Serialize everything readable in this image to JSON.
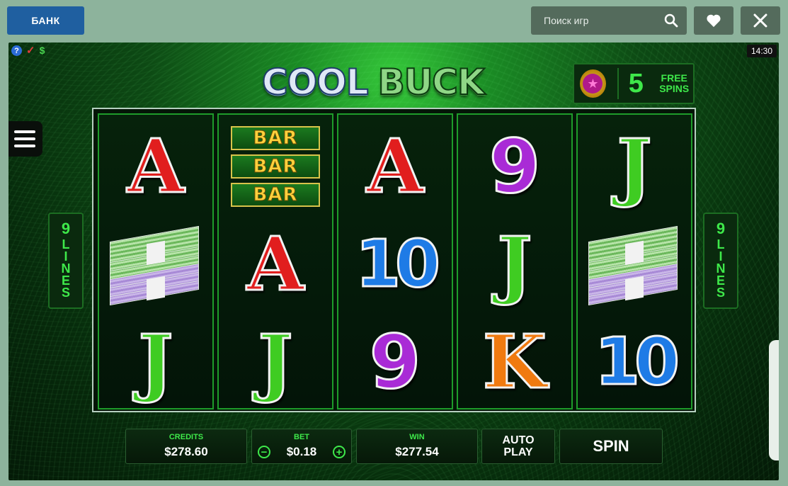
{
  "topbar": {
    "bank_label": "БАНК",
    "search_placeholder": "Поиск игр"
  },
  "icons": {
    "search": "search-icon",
    "favorite": "heart-icon",
    "close": "close-icon",
    "help": "?",
    "check": "✓",
    "dollar": "$"
  },
  "game": {
    "clock": "14:30",
    "logo_word1": "COOL",
    "logo_word2": "BUCK",
    "free_spins_count": "5",
    "free_spins_label_1": "FREE",
    "free_spins_label_2": "SPINS",
    "lines_number": "9",
    "lines_text": [
      "L",
      "I",
      "N",
      "E",
      "S"
    ]
  },
  "reels": [
    [
      "A",
      "cash",
      "J"
    ],
    [
      "BAR",
      "A",
      "J"
    ],
    [
      "A",
      "10",
      "9"
    ],
    [
      "9",
      "J",
      "K"
    ],
    [
      "J",
      "cash",
      "10"
    ]
  ],
  "bar_label": "BAR",
  "panel": {
    "credits_label": "CREDITS",
    "credits_value": "$278.60",
    "bet_label": "BET",
    "bet_value": "$0.18",
    "bet_minus": "−",
    "bet_plus": "+",
    "win_label": "WIN",
    "win_value": "$277.54",
    "auto_play_1": "AUTO",
    "auto_play_2": "PLAY",
    "spin_label": "SPIN"
  },
  "colors": {
    "bank_button": "#1f5fa0",
    "topbar_control": "#546b5c",
    "accent_green": "#3ee84a"
  }
}
